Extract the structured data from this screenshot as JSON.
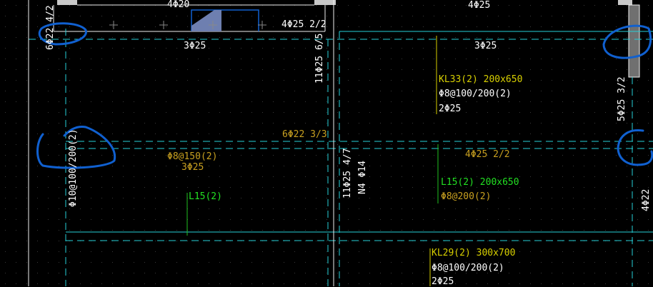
{
  "colors": {
    "background": "#000000",
    "beam_line": "#26d0d8",
    "wall": "#f0f0f0",
    "white_text": "#ffffff",
    "yellow_text": "#d8d000",
    "green_text": "#22e022",
    "orange_text": "#c8a020",
    "annotation": "#1060d0",
    "column_fill": "#707070",
    "leader_green": "#20c020",
    "leader_yellow": "#d8d000"
  },
  "labels": {
    "top_left_4d20": "4Φ20",
    "top_right_4d25": "4Φ25",
    "top_mid_4d25_22": "4Φ25 2/2",
    "left_vert_6d22": "6Φ22 4/2",
    "span1_3d25": "3Φ25",
    "span2_3d25": "3Φ25",
    "vert_11d25_65": "11Φ25 6/5",
    "kl33_name": "KL33(2) 200x650",
    "kl33_stirrup": "Φ8@100/200(2)",
    "kl33_top": "2Φ25",
    "right_vert_5d25": "5Φ25 3/2",
    "mid_6d22": "6Φ22 3/3",
    "left_stirrup": "Φ8@150(2)",
    "left_3d25": "3Φ25",
    "left_vert_stirrup": "Φ10@100/200(2)",
    "l15_left": "L15(2)",
    "vert_11d25_47": "11Φ25 4/7",
    "vert_n4": "N4 Φ14",
    "right_4d25_22": "4Φ25 2/2",
    "l15_right_name": "L15(2) 200x650",
    "l15_right_stirrup": "Φ8@200(2)",
    "far_right_4d22": "4Φ22",
    "kl29_name": "KL29(2) 300x700",
    "kl29_stirrup": "Φ8@100/200(2)",
    "kl29_top": "2Φ25"
  },
  "icons": [
    "blue-annotation-circle",
    "crosshair-marker",
    "blue-section-shape"
  ]
}
